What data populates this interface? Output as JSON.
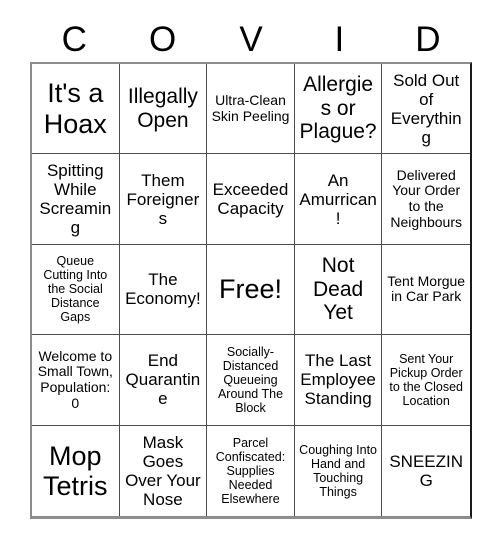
{
  "card": {
    "header_letters": [
      "C",
      "O",
      "V",
      "I",
      "D"
    ],
    "columns": 5,
    "rows": 5,
    "free_space_index": 12,
    "colors": {
      "text": "#000000",
      "cell_background": "#ffffff",
      "grid_line": "#4d4d4d",
      "outer_border": "#8c8c8c",
      "page_background": "#ffffff"
    },
    "cells": [
      {
        "text": "It's a Hoax",
        "size": "xl"
      },
      {
        "text": "Illegally Open",
        "size": "lg"
      },
      {
        "text": "Ultra-Clean Skin Peeling",
        "size": "sm"
      },
      {
        "text": "Allergies or Plague?",
        "size": "lg"
      },
      {
        "text": "Sold Out of Everything",
        "size": "md"
      },
      {
        "text": "Spitting While Screaming",
        "size": "md"
      },
      {
        "text": "Them Foreigners",
        "size": "md"
      },
      {
        "text": "Exceeded Capacity",
        "size": "md"
      },
      {
        "text": "An Amurrican!",
        "size": "md"
      },
      {
        "text": "Delivered Your Order to the Neighbours",
        "size": "sm"
      },
      {
        "text": "Queue Cutting Into the Social Distance Gaps",
        "size": "xs"
      },
      {
        "text": "The Economy!",
        "size": "md"
      },
      {
        "text": "Free!",
        "size": "xl"
      },
      {
        "text": "Not Dead Yet",
        "size": "lg"
      },
      {
        "text": "Tent Morgue in Car Park",
        "size": "sm"
      },
      {
        "text": "Welcome to Small Town, Population: 0",
        "size": "sm"
      },
      {
        "text": "End Quarantine",
        "size": "md"
      },
      {
        "text": "Socially-Distanced Queueing Around The Block",
        "size": "xs"
      },
      {
        "text": "The Last Employee Standing",
        "size": "md"
      },
      {
        "text": "Sent Your Pickup Order to the Closed Location",
        "size": "xs"
      },
      {
        "text": "Mop Tetris",
        "size": "xl"
      },
      {
        "text": "Mask Goes Over Your Nose",
        "size": "md"
      },
      {
        "text": "Parcel Confiscated: Supplies Needed Elsewhere",
        "size": "xs"
      },
      {
        "text": "Coughing Into Hand and Touching Things",
        "size": "xs"
      },
      {
        "text": "SNEEZING",
        "size": "md"
      }
    ]
  }
}
